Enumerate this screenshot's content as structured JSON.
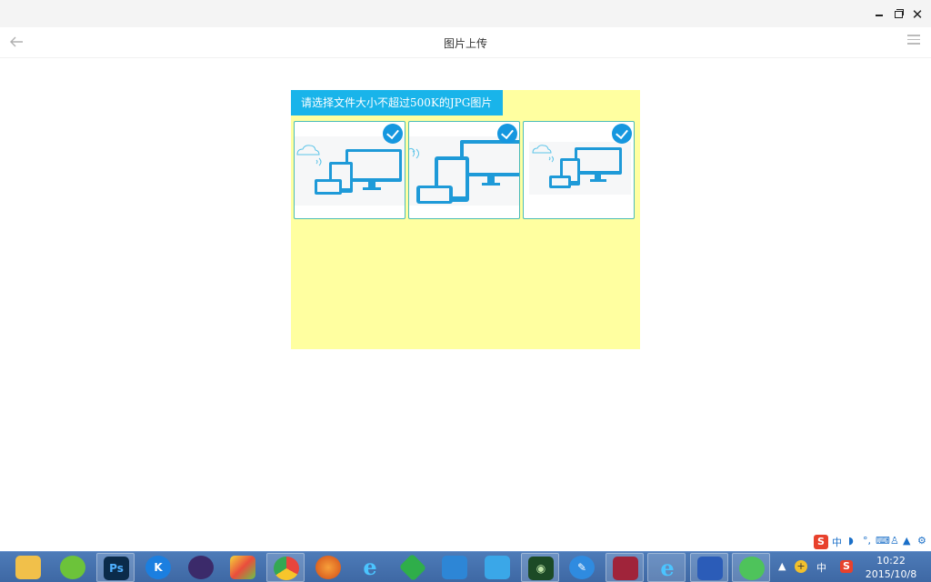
{
  "window": {
    "title": "图片上传",
    "close_glyph": "✕"
  },
  "upload": {
    "hint": "请选择文件大小不超过500K的JPG图片",
    "images": [
      {
        "selected": true,
        "icon": "devices-illustration"
      },
      {
        "selected": true,
        "icon": "devices-illustration"
      },
      {
        "selected": true,
        "icon": "devices-illustration"
      }
    ]
  },
  "ime": {
    "sogou": "S",
    "lang": "中"
  },
  "taskbar": {
    "apps": [
      "file-explorer-icon",
      "app-green-icon",
      "photoshop-icon",
      "kugou-icon",
      "eclipse-icon",
      "app-colorful-icon",
      "chrome-icon",
      "firefox-icon",
      "ie-icon",
      "download-icon",
      "cloud-icon",
      "baidu-cloud-icon",
      "eye-app-icon",
      "pen-app-icon",
      "winrar-icon",
      "ie2-icon",
      "remote-desktop-icon",
      "wechat-icon"
    ],
    "ps_label": "Ps",
    "k_label": "K",
    "tray_lang": "中",
    "clock_time": "10:22",
    "clock_date": "2015/10/8"
  },
  "colors": {
    "accent": "#19b4ea",
    "panel": "#ffffa0",
    "check": "#1597df"
  }
}
